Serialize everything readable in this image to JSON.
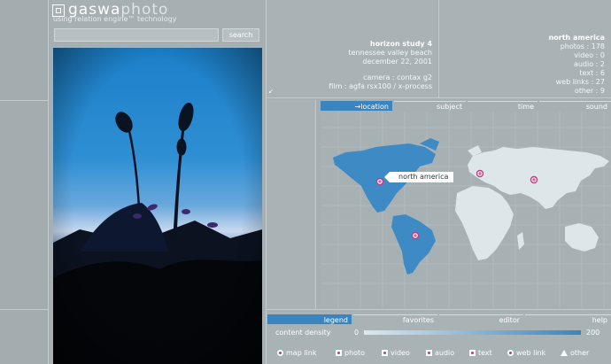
{
  "brand": {
    "logo_part1": "gaswa",
    "logo_part2": "photo",
    "tagline": "using relation engine™ technology"
  },
  "search": {
    "button_label": "search",
    "value": ""
  },
  "photo_info": {
    "title": "horizon study 4",
    "location": "tennessee valley beach",
    "date": "december 22, 2001",
    "camera": "camera : contax g2",
    "film": "film : agfa rsx100 / x-process"
  },
  "region_stats": {
    "title": "north america",
    "rows": [
      "photos : 178",
      "video : 0",
      "audio : 2",
      "text : 6",
      "web links : 27",
      "other : 9"
    ]
  },
  "top_tabs": [
    {
      "label": "→location",
      "active": true
    },
    {
      "label": "subject",
      "active": false
    },
    {
      "label": "time",
      "active": false
    },
    {
      "label": "sound",
      "active": false
    }
  ],
  "map": {
    "callout": "north america",
    "colors": {
      "land": "#dde6e8",
      "highlight": "#3e8ac4",
      "grid": "#b9c3c6"
    }
  },
  "bottom_tabs": [
    {
      "label": "legend",
      "active": true
    },
    {
      "label": "favorites",
      "active": false
    },
    {
      "label": "editor",
      "active": false
    },
    {
      "label": "help",
      "active": false
    }
  ],
  "density": {
    "label": "content density",
    "min": "0",
    "max": "200"
  },
  "legend": [
    {
      "label": "map link",
      "icon": "map-link-icon"
    },
    {
      "label": "photo",
      "icon": "photo-icon"
    },
    {
      "label": "video",
      "icon": "video-icon"
    },
    {
      "label": "audio",
      "icon": "audio-icon"
    },
    {
      "label": "text",
      "icon": "text-icon"
    },
    {
      "label": "web link",
      "icon": "web-link-icon"
    },
    {
      "label": "other",
      "icon": "other-icon"
    }
  ],
  "accent_color": "#3a84c0"
}
